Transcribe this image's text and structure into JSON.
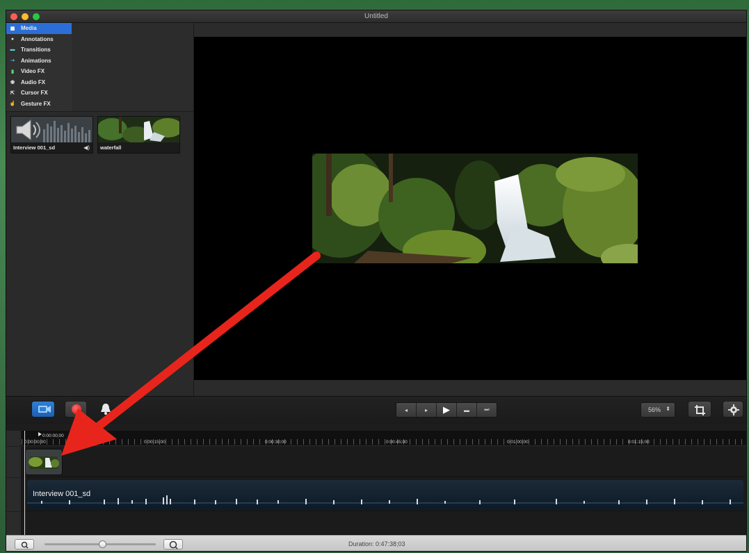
{
  "window": {
    "title": "Untitled"
  },
  "sidebar": {
    "categories": [
      {
        "label": "Media",
        "icon": "media-icon",
        "active": true
      },
      {
        "label": "Annotations",
        "icon": "annotations-icon",
        "active": false
      },
      {
        "label": "Transitions",
        "icon": "transitions-icon",
        "active": false
      },
      {
        "label": "Animations",
        "icon": "animations-icon",
        "active": false
      },
      {
        "label": "Video FX",
        "icon": "video-fx-icon",
        "active": false
      },
      {
        "label": "Audio FX",
        "icon": "audio-fx-icon",
        "active": false
      },
      {
        "label": "Cursor FX",
        "icon": "cursor-fx-icon",
        "active": false
      },
      {
        "label": "Gesture FX",
        "icon": "gesture-fx-icon",
        "active": false
      }
    ],
    "media": [
      {
        "label": "Interview 001_sd",
        "type": "audio"
      },
      {
        "label": "waterfall",
        "type": "image"
      }
    ]
  },
  "toolbar": {
    "zoom_value": "56%",
    "transport": [
      "◂",
      "▸",
      "▶",
      "▬",
      "⏭"
    ]
  },
  "timeline": {
    "playhead_time": "0:00:00;00",
    "ticks": [
      "0:00:00;00",
      "0:00:15;00",
      "0:00:30;00",
      "0:00:45;00",
      "0:01:00;00",
      "0:01:15;00"
    ],
    "audio_track_label": "Interview 001_sd"
  },
  "status": {
    "duration": "Duration: 0:47:38;03"
  },
  "colors": {
    "accent": "#2b6fd6",
    "record": "#d81010",
    "annotation_arrow": "#e8251c"
  }
}
